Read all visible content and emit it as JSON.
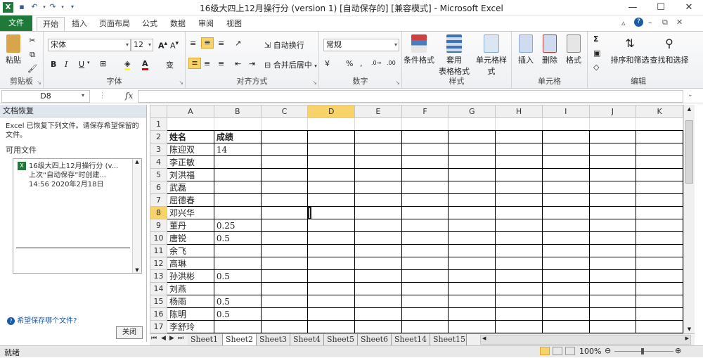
{
  "window": {
    "title": "16级大四上12月操行分 (version 1) [自动保存的]  [兼容模式] - Microsoft Excel"
  },
  "tabs": [
    "文件",
    "开始",
    "插入",
    "页面布局",
    "公式",
    "数据",
    "审阅",
    "视图"
  ],
  "ribbon": {
    "clipboard": {
      "label": "剪贴板",
      "paste": "粘贴"
    },
    "font": {
      "label": "字体",
      "name": "宋体",
      "size": "12"
    },
    "alignment": {
      "label": "对齐方式",
      "wrap": "自动换行",
      "merge": "合并后居中"
    },
    "number": {
      "label": "数字",
      "format": "常规"
    },
    "styles": {
      "label": "样式",
      "cond": "条件格式",
      "table_l1": "套用",
      "table_l2": "表格格式",
      "cell": "单元格样式"
    },
    "cells": {
      "label": "单元格",
      "insert": "插入",
      "delete": "删除",
      "format": "格式"
    },
    "editing": {
      "label": "编辑",
      "sort": "排序和筛选",
      "find": "查找和选择"
    }
  },
  "formula_bar": {
    "name_box": "D8",
    "fx": "fx",
    "value": ""
  },
  "recovery_pane": {
    "title": "文档恢复",
    "message": "Excel 已恢复下列文件。请保存希望保留的文件。",
    "available": "可用文件",
    "file_name": "16级大四上12月操行分 (v...",
    "file_line2": "上次“自动保存”时创建...",
    "file_line3": "14:56 2020年2月18日",
    "help": "希望保存哪个文件?",
    "close": "关闭"
  },
  "grid": {
    "columns": [
      "A",
      "B",
      "C",
      "D",
      "E",
      "F",
      "G",
      "H",
      "I",
      "J",
      "K"
    ],
    "selected_column": "D",
    "selected_row": 8,
    "rows": [
      {
        "n": "1",
        "a": "",
        "b": ""
      },
      {
        "n": "2",
        "a": "姓名",
        "b": "成绩"
      },
      {
        "n": "3",
        "a": "陈迎双",
        "b": "14"
      },
      {
        "n": "4",
        "a": "李正敏",
        "b": ""
      },
      {
        "n": "5",
        "a": "刘洪福",
        "b": ""
      },
      {
        "n": "6",
        "a": "武磊",
        "b": ""
      },
      {
        "n": "7",
        "a": "屈德春",
        "b": ""
      },
      {
        "n": "8",
        "a": "邓兴华",
        "b": ""
      },
      {
        "n": "9",
        "a": "董丹",
        "b": "0.25"
      },
      {
        "n": "10",
        "a": "唐锐",
        "b": "0.5"
      },
      {
        "n": "11",
        "a": "余飞",
        "b": ""
      },
      {
        "n": "12",
        "a": "高琳",
        "b": ""
      },
      {
        "n": "13",
        "a": "孙洪彬",
        "b": "0.5"
      },
      {
        "n": "14",
        "a": "刘燕",
        "b": ""
      },
      {
        "n": "15",
        "a": "杨雨",
        "b": "0.5"
      },
      {
        "n": "16",
        "a": "陈明",
        "b": "0.5"
      },
      {
        "n": "17",
        "a": "李舒玲",
        "b": ""
      }
    ]
  },
  "sheets": [
    "Sheet1",
    "Sheet2",
    "Sheet3",
    "Sheet4",
    "Sheet5",
    "Sheet6",
    "Sheet14",
    "Sheet15"
  ],
  "active_sheet": "Sheet2",
  "status": {
    "mode": "就绪",
    "zoom": "100%"
  },
  "colors": {
    "file_tab": "#1f7a3a",
    "selection": "#f8d36a",
    "pane_header": "#dfe6ee"
  }
}
